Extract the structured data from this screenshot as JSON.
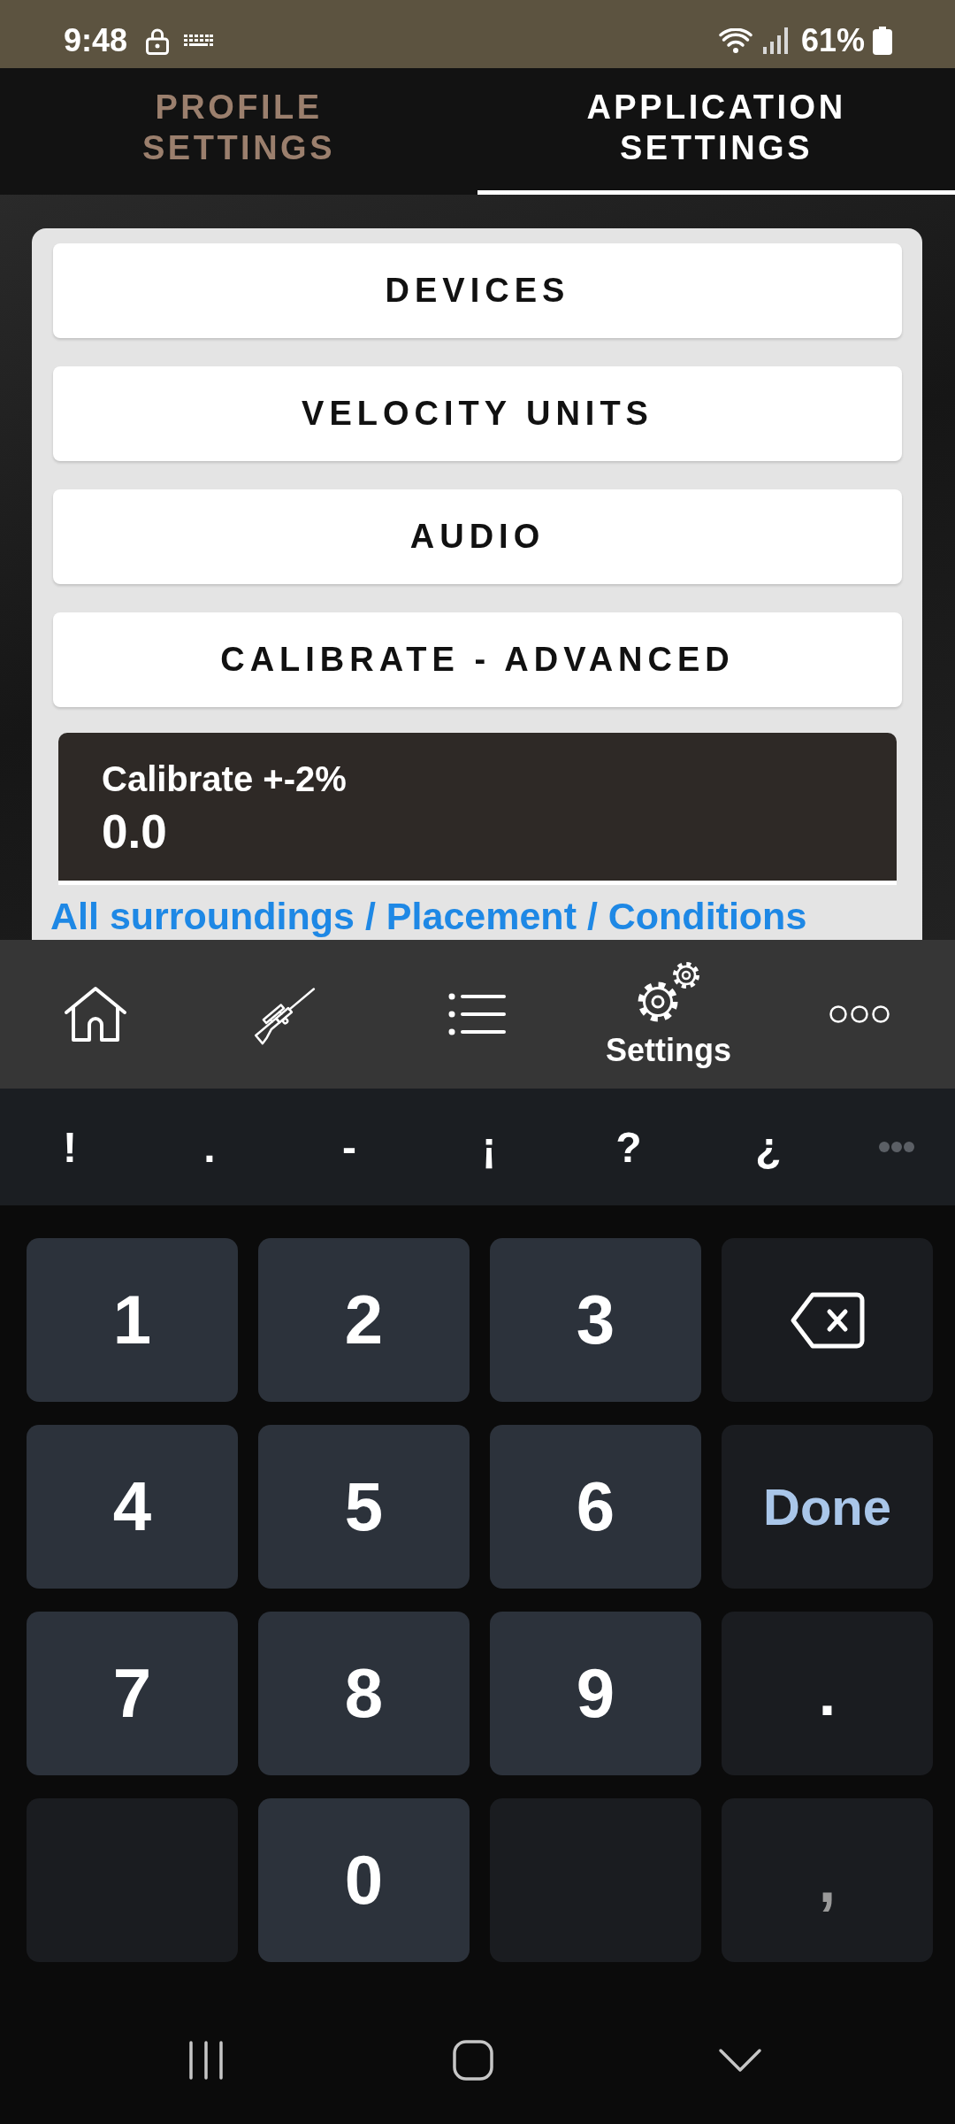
{
  "status_bar": {
    "time": "9:48",
    "battery": "61%"
  },
  "tabs": [
    {
      "label": "PROFILE SETTINGS",
      "selected": false
    },
    {
      "label": "APPLICATION SETTINGS",
      "selected": true
    }
  ],
  "menu_buttons": [
    "DEVICES",
    "VELOCITY UNITS",
    "AUDIO",
    "CALIBRATE - ADVANCED"
  ],
  "calibrate_field": {
    "label": "Calibrate +-2%",
    "value": "0.0"
  },
  "link": "All surroundings / Placement / Conditions",
  "bottom_nav": [
    {
      "selected": false
    },
    {
      "selected": false
    },
    {
      "selected": false
    },
    {
      "label": "Settings",
      "selected": true
    },
    {
      "selected": false
    }
  ],
  "symbol_row": [
    "!",
    ".",
    "-",
    "¡",
    "?",
    "¿"
  ],
  "keypad": [
    {
      "kind": "digit",
      "label": "1",
      "disabled": false
    },
    {
      "kind": "digit",
      "label": "2",
      "disabled": false
    },
    {
      "kind": "digit",
      "label": "3",
      "disabled": false
    },
    {
      "kind": "backspace",
      "disabled": false
    },
    {
      "kind": "digit",
      "label": "4",
      "disabled": false
    },
    {
      "kind": "digit",
      "label": "5",
      "disabled": false
    },
    {
      "kind": "digit",
      "label": "6",
      "disabled": false
    },
    {
      "kind": "done",
      "label": "Done",
      "disabled": false
    },
    {
      "kind": "digit",
      "label": "7",
      "disabled": false
    },
    {
      "kind": "digit",
      "label": "8",
      "disabled": false
    },
    {
      "kind": "digit",
      "label": "9",
      "disabled": false
    },
    {
      "kind": "symbol",
      "label": ".",
      "disabled": false
    },
    {
      "kind": "blank"
    },
    {
      "kind": "digit",
      "label": "0",
      "disabled": false
    },
    {
      "kind": "blank"
    },
    {
      "kind": "symbol",
      "label": ",",
      "disabled": true
    }
  ]
}
